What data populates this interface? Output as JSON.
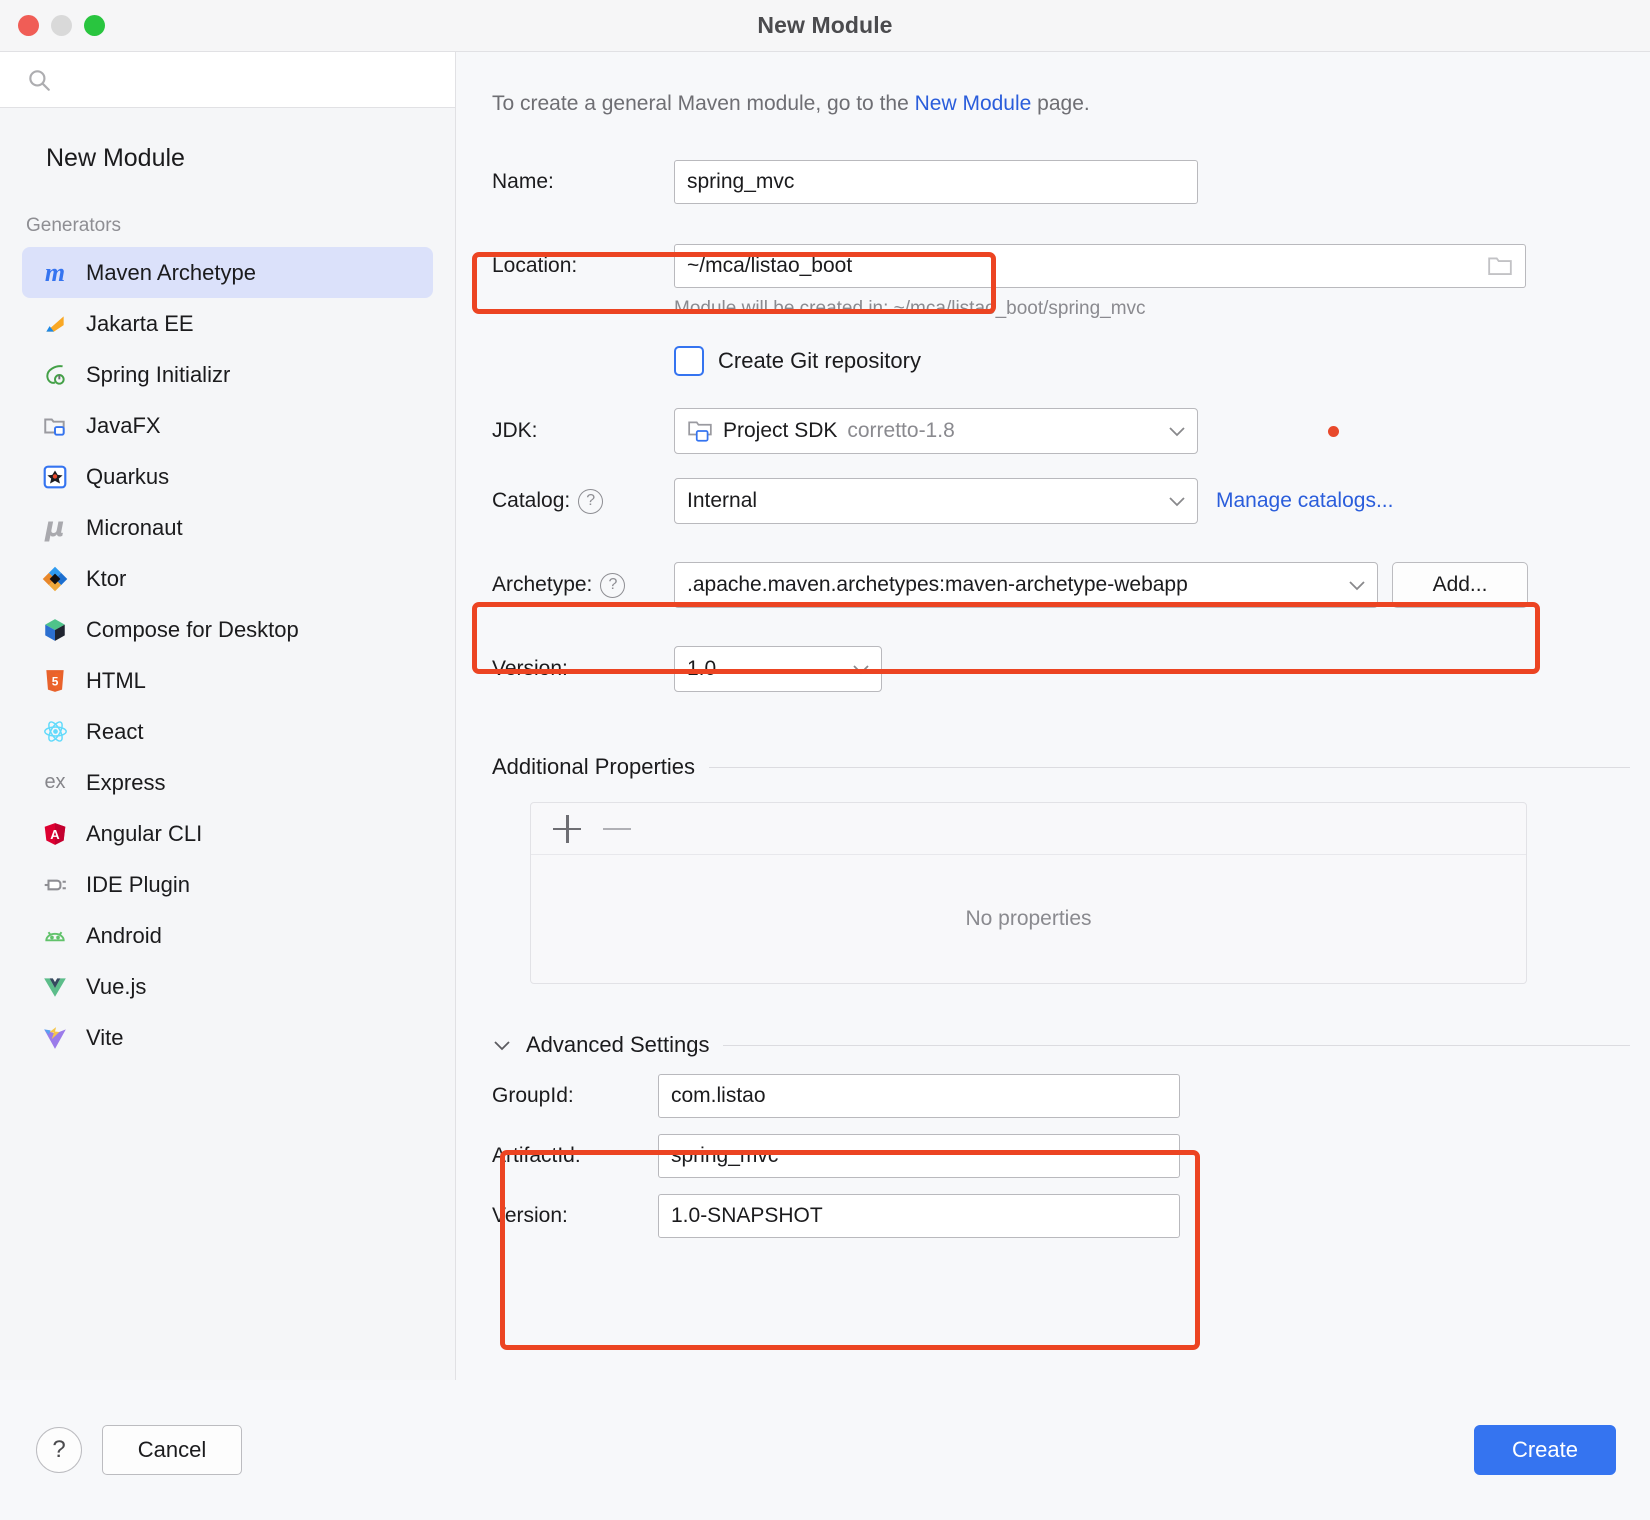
{
  "window": {
    "title": "New Module",
    "traffic_lights": [
      "close",
      "minimize",
      "zoom"
    ]
  },
  "sidebar": {
    "search_placeholder": "",
    "search_value": "",
    "heading": "New Module",
    "section_label": "Generators",
    "items": [
      {
        "label": "Maven Archetype",
        "icon": "maven-icon",
        "selected": true
      },
      {
        "label": "Jakarta EE",
        "icon": "jakarta-ee-icon",
        "selected": false
      },
      {
        "label": "Spring Initializr",
        "icon": "spring-icon",
        "selected": false
      },
      {
        "label": "JavaFX",
        "icon": "javafx-icon",
        "selected": false
      },
      {
        "label": "Quarkus",
        "icon": "quarkus-icon",
        "selected": false
      },
      {
        "label": "Micronaut",
        "icon": "micronaut-icon",
        "selected": false
      },
      {
        "label": "Ktor",
        "icon": "ktor-icon",
        "selected": false
      },
      {
        "label": "Compose for Desktop",
        "icon": "compose-icon",
        "selected": false
      },
      {
        "label": "HTML",
        "icon": "html5-icon",
        "selected": false
      },
      {
        "label": "React",
        "icon": "react-icon",
        "selected": false
      },
      {
        "label": "Express",
        "icon": "express-icon",
        "selected": false
      },
      {
        "label": "Angular CLI",
        "icon": "angular-icon",
        "selected": false
      },
      {
        "label": "IDE Plugin",
        "icon": "plugin-icon",
        "selected": false
      },
      {
        "label": "Android",
        "icon": "android-icon",
        "selected": false
      },
      {
        "label": "Vue.js",
        "icon": "vue-icon",
        "selected": false
      },
      {
        "label": "Vite",
        "icon": "vite-icon",
        "selected": false
      }
    ]
  },
  "main": {
    "intro_before": "To create a general Maven module, go to the ",
    "intro_link": "New Module",
    "intro_after": " page.",
    "name": {
      "label": "Name:",
      "value": "spring_mvc"
    },
    "location": {
      "label": "Location:",
      "value": "~/mca/listao_boot",
      "browse_icon": "folder-icon"
    },
    "location_hint": "Module will be created in: ~/mca/listao_boot/spring_mvc",
    "git": {
      "label": "Create Git repository",
      "checked": false
    },
    "jdk": {
      "label": "JDK:",
      "value_main": "Project SDK",
      "value_muted": "corretto-1.8",
      "icon": "jdk-folder-icon"
    },
    "catalog": {
      "label": "Catalog:",
      "value": "Internal",
      "help": "?",
      "manage_link": "Manage catalogs..."
    },
    "archetype": {
      "label": "Archetype:",
      "value": ".apache.maven.archetypes:maven-archetype-webapp",
      "help": "?",
      "add_button": "Add..."
    },
    "version": {
      "label": "Version:",
      "value": "1.0"
    },
    "additional_properties": {
      "title": "Additional Properties",
      "add_icon": "plus-icon",
      "remove_icon": "minus-icon",
      "empty_text": "No properties"
    },
    "advanced_settings": {
      "title": "Advanced Settings",
      "collapse_icon": "chevron-down-icon",
      "fields": [
        {
          "label": "GroupId:",
          "value": "com.listao"
        },
        {
          "label": "ArtifactId:",
          "value": "spring_mvc"
        },
        {
          "label": "Version:",
          "value": "1.0-SNAPSHOT"
        }
      ]
    },
    "error_indicator": "error-dot"
  },
  "footer": {
    "help_label": "?",
    "cancel_label": "Cancel",
    "create_label": "Create"
  },
  "colors": {
    "accent": "#3574f0",
    "link": "#2a5ddb",
    "highlight": "#ec4422",
    "selected_row": "#dbe1fa",
    "error": "#e8492b"
  }
}
